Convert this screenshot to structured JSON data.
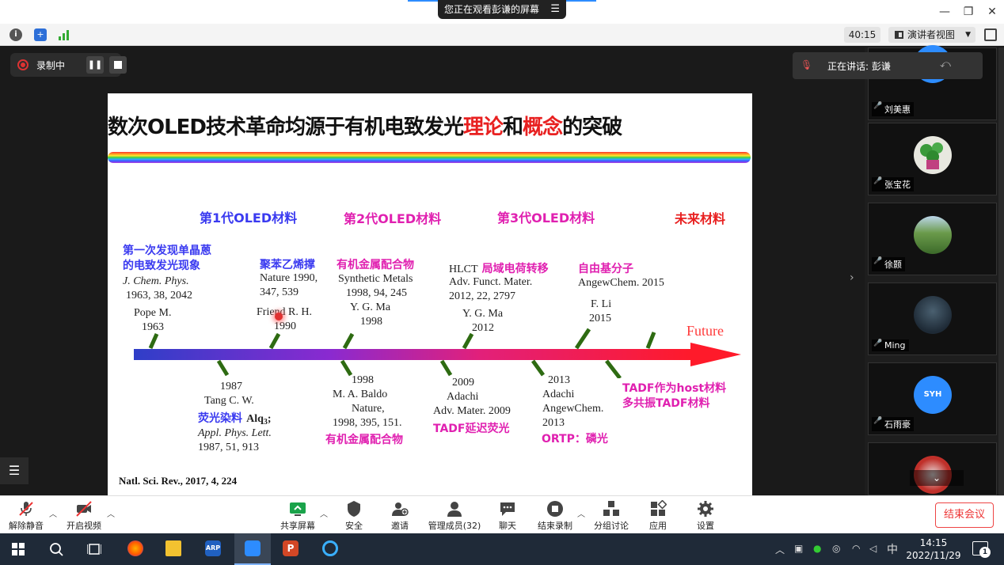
{
  "window": {
    "sharing_banner": "您正在观看彭谦的屏幕",
    "timer": "40:15",
    "view_button": "演讲者视图"
  },
  "recording": {
    "label": "录制中"
  },
  "speaker": {
    "text": "正在讲话: 彭谦"
  },
  "slide": {
    "title_a": "数次OLED技术革命均源于有机电致发光",
    "title_b": "理论",
    "title_c": "和",
    "title_d": "概念",
    "title_e": "的突破",
    "gen1": "第1代OLED材料",
    "gen2": "第2代OLED材料",
    "gen3": "第3代OLED材料",
    "future_mat": "未来材料",
    "future": "Future",
    "top1_cn": [
      "第一次发现单晶蒽",
      "的电致发光现象"
    ],
    "top1_ref": [
      "J. Chem. Phys.",
      "1963, 38, 2042"
    ],
    "top1_author": [
      "Pope M.",
      "1963"
    ],
    "top2_cn": "聚苯乙烯撑",
    "top2_ref": [
      "Nature 1990,",
      "347, 539"
    ],
    "top2_author": [
      "Friend R. H.",
      "1990"
    ],
    "top3_cn": "有机金属配合物",
    "top3_ref": [
      "Synthetic Metals",
      "1998, 94, 245",
      "Y. G. Ma",
      "1998"
    ],
    "top4_lbl": "HLCT",
    "top4_cn": "局域电荷转移",
    "top4_ref": [
      "Adv. Funct. Mater.",
      "2012, 22, 2797"
    ],
    "top4_author": [
      "Y. G. Ma",
      "2012"
    ],
    "top5_cn": "自由基分子",
    "top5_ref": "AngewChem. 2015",
    "top5_author": [
      "F. Li",
      "2015"
    ],
    "bot1": [
      "1987",
      "Tang C. W."
    ],
    "bot1_cn": "荧光染料",
    "bot1_alq": "Alq",
    "bot1_sub": "3",
    "bot1_semi": ";",
    "bot1_ref": [
      "Appl. Phys. Lett.",
      "1987, 51, 913"
    ],
    "bot2": [
      "1998",
      "M. A. Baldo",
      "Nature,",
      "1998, 395, 151."
    ],
    "bot2_cn": "有机金属配合物",
    "bot3": [
      "2009",
      "Adachi",
      "Adv. Mater. 2009"
    ],
    "bot3_cn": "TADF延迟荧光",
    "bot4": [
      "2013",
      "Adachi",
      "AngewChem.",
      "2013"
    ],
    "bot4_cn": "ORTP：磷光",
    "bot5_cn": [
      "TADF作为host材料",
      "多共振TADF材料"
    ],
    "citation": "Natl. Sci. Rev., 2017, 4, 224"
  },
  "gallery": [
    {
      "name": "刘美惠",
      "avatar_color": "#2d8cff"
    },
    {
      "name": "张宝花",
      "avatar_color": "#e8e8e0"
    },
    {
      "name": "徐颢",
      "avatar_color": "#4c7a3a"
    },
    {
      "name": "Ming",
      "avatar_color": "#2a3a4a"
    },
    {
      "name": "石雨豪",
      "avatar_color": "#2d8cff",
      "initials": "SYH"
    },
    {
      "name": "",
      "avatar_color": "#c0302a"
    }
  ],
  "controls": {
    "unmute": "解除静音",
    "video": "开启视频",
    "share": "共享屏幕",
    "security": "安全",
    "invite": "邀请",
    "participants": "管理成员(32)",
    "chat": "聊天",
    "end_record": "结束录制",
    "breakout": "分组讨论",
    "apps": "应用",
    "settings": "设置",
    "end_meeting": "结束会议"
  },
  "taskbar": {
    "time": "14:15",
    "date": "2022/11/29",
    "ime": "中",
    "notif_count": "1"
  },
  "colors": {
    "accent_blue": "#2d8cff",
    "slide_blue": "#3a3af0",
    "slide_magenta": "#e020b0",
    "slide_red": "#e82020",
    "arrow_green": "#2e6b12"
  }
}
